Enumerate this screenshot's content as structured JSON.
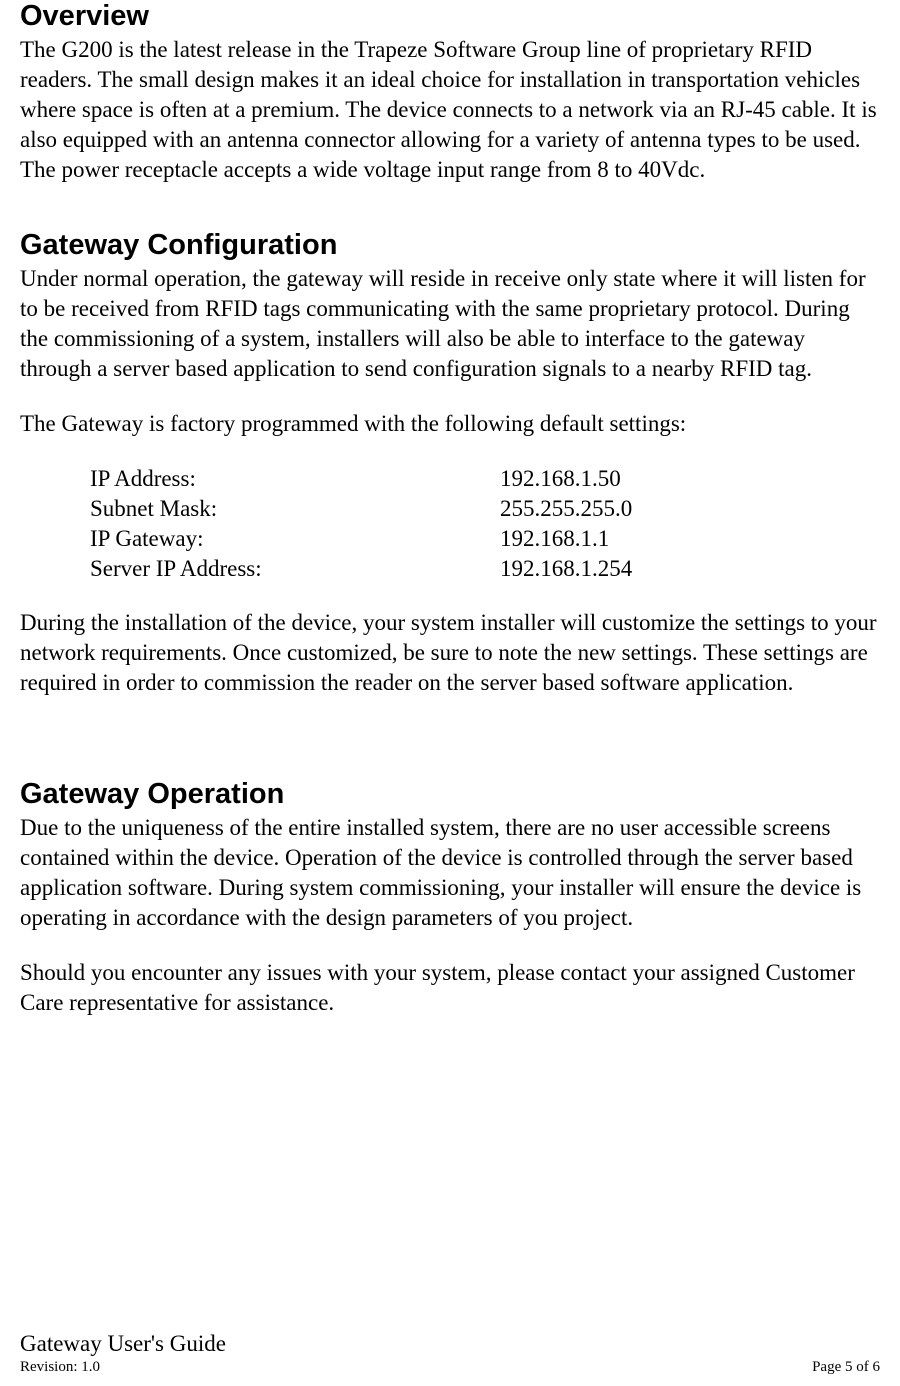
{
  "sections": {
    "overview": {
      "heading": "Overview",
      "para1": "The G200 is the latest release in the Trapeze Software Group line of proprietary RFID readers.  The small design makes it an ideal choice for installation in transportation vehicles where space is often at a premium.  The device connects to a network via an RJ-45 cable.  It is also equipped with an antenna connector allowing for a variety of antenna types to be used.  The power receptacle accepts a wide voltage input range from 8 to 40Vdc."
    },
    "config": {
      "heading": "Gateway Configuration",
      "para1": "Under normal operation, the gateway will reside in receive only state where it will listen for to be received from RFID tags communicating with the same proprietary protocol.  During the commissioning of a system, installers will also be able to interface to the gateway through a server based application to send configuration signals to a nearby RFID tag.",
      "para2": "The Gateway is factory programmed with the following default settings:",
      "settings": [
        {
          "label": "IP Address:",
          "value": "192.168.1.50"
        },
        {
          "label": "Subnet Mask:",
          "value": "255.255.255.0"
        },
        {
          "label": "IP Gateway:",
          "value": "192.168.1.1"
        },
        {
          "label": "Server IP Address:",
          "value": "192.168.1.254"
        }
      ],
      "para3": "During the installation of the device, your system installer will customize the settings to your network requirements.  Once customized, be sure to note the new settings.  These settings are required in order to commission the reader on the server based software application."
    },
    "operation": {
      "heading": "Gateway Operation",
      "para1": "Due to the uniqueness of the entire installed system, there are no user accessible screens contained within the device.  Operation of the device is controlled through the server based application software.     During system commissioning, your installer will ensure the device is operating in accordance with the design parameters of you project.",
      "para2": "Should you encounter any issues with your system, please contact your assigned Customer Care representative for assistance."
    }
  },
  "footer": {
    "title": "Gateway User's Guide",
    "revision": "Revision: 1.0",
    "page": "Page 5 of 6"
  }
}
